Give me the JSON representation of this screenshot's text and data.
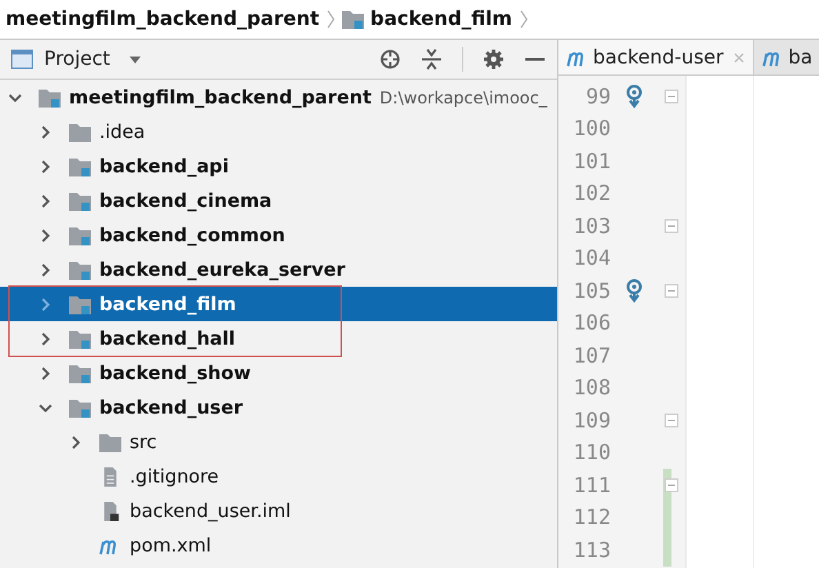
{
  "breadcrumb": [
    {
      "label": "meetingfilm_backend_parent"
    },
    {
      "label": "backend_film",
      "kind": "module"
    }
  ],
  "panel": {
    "title": "Project"
  },
  "tree": [
    {
      "label": "meetingfilm_backend_parent",
      "path": "D:\\workapce\\imooc_",
      "kind": "module",
      "expanded": true,
      "selected": false,
      "children": [
        {
          "label": ".idea",
          "kind": "folder",
          "expanded": false,
          "selected": false
        },
        {
          "label": "backend_api",
          "kind": "module",
          "expanded": false,
          "selected": false
        },
        {
          "label": "backend_cinema",
          "kind": "module",
          "expanded": false,
          "selected": false
        },
        {
          "label": "backend_common",
          "kind": "module",
          "expanded": false,
          "selected": false
        },
        {
          "label": "backend_eureka_server",
          "kind": "module",
          "expanded": false,
          "selected": false
        },
        {
          "label": "backend_film",
          "kind": "module",
          "expanded": false,
          "selected": true
        },
        {
          "label": "backend_hall",
          "kind": "module",
          "expanded": false,
          "selected": false
        },
        {
          "label": "backend_show",
          "kind": "module",
          "expanded": false,
          "selected": false
        },
        {
          "label": "backend_user",
          "kind": "module",
          "expanded": true,
          "selected": false,
          "children": [
            {
              "label": "src",
              "kind": "folder",
              "expanded": false,
              "selected": false
            },
            {
              "label": ".gitignore",
              "kind": "text",
              "selected": false
            },
            {
              "label": "backend_user.iml",
              "kind": "iml",
              "selected": false
            },
            {
              "label": "pom.xml",
              "kind": "pom",
              "selected": false
            }
          ]
        }
      ]
    }
  ],
  "editor_tabs": [
    {
      "label": "backend-user",
      "selected": true
    },
    {
      "label": "ba",
      "selected": false
    }
  ],
  "gutter": [
    {
      "number": "99",
      "marker": true,
      "fold": true,
      "changed": false
    },
    {
      "number": "100",
      "marker": false,
      "fold": false,
      "changed": false
    },
    {
      "number": "101",
      "marker": false,
      "fold": false,
      "changed": false
    },
    {
      "number": "102",
      "marker": false,
      "fold": false,
      "changed": false
    },
    {
      "number": "103",
      "marker": false,
      "fold": true,
      "changed": false
    },
    {
      "number": "104",
      "marker": false,
      "fold": false,
      "changed": false
    },
    {
      "number": "105",
      "marker": true,
      "fold": true,
      "changed": false
    },
    {
      "number": "106",
      "marker": false,
      "fold": false,
      "changed": false
    },
    {
      "number": "107",
      "marker": false,
      "fold": false,
      "changed": false
    },
    {
      "number": "108",
      "marker": false,
      "fold": false,
      "changed": false
    },
    {
      "number": "109",
      "marker": false,
      "fold": true,
      "changed": false
    },
    {
      "number": "110",
      "marker": false,
      "fold": false,
      "changed": false
    },
    {
      "number": "111",
      "marker": false,
      "fold": true,
      "changed": true
    },
    {
      "number": "112",
      "marker": false,
      "fold": false,
      "changed": true
    },
    {
      "number": "113",
      "marker": false,
      "fold": false,
      "changed": true
    }
  ]
}
